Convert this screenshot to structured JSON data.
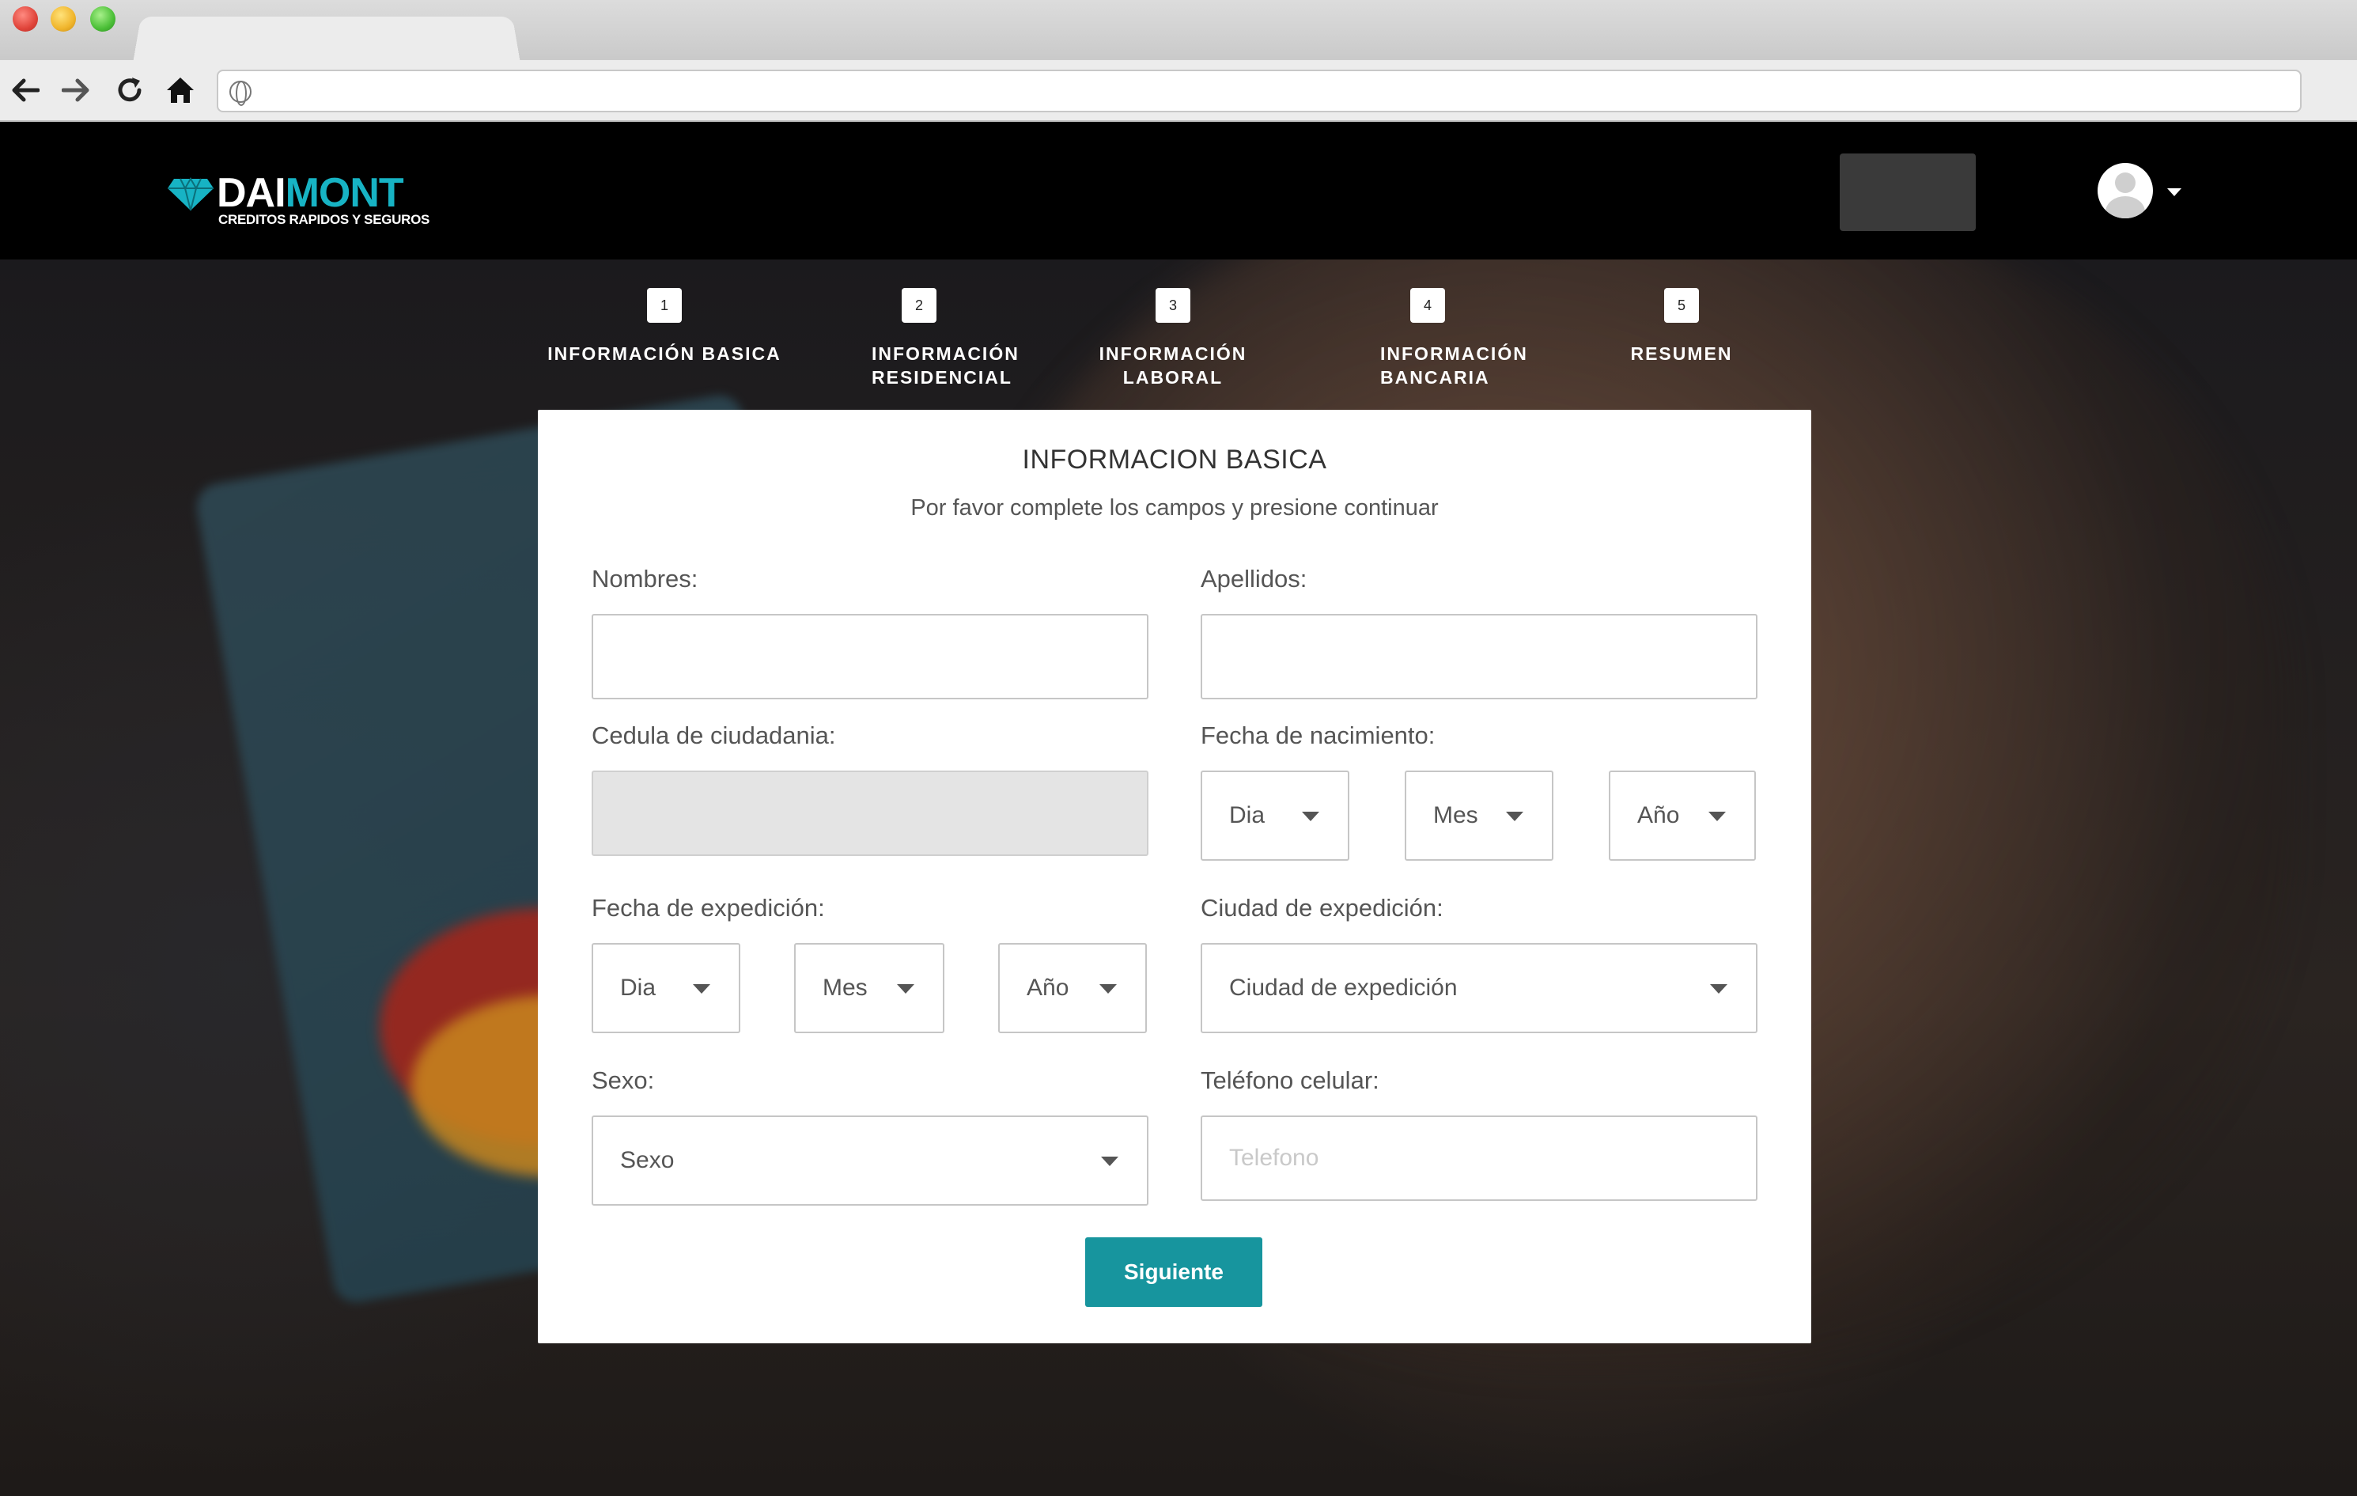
{
  "browser": {
    "url": ""
  },
  "brand": {
    "name_part1": "DAI",
    "name_part2": "MONT",
    "tagline": "CREDITOS RAPIDOS Y SEGUROS",
    "accent_color": "#17b3c4"
  },
  "steps": [
    {
      "number": "1",
      "label": "INFORMACIÓN BASICA"
    },
    {
      "number": "2",
      "label": "INFORMACIÓN RESIDENCIAL"
    },
    {
      "number": "3",
      "label": "INFORMACIÓN LABORAL"
    },
    {
      "number": "4",
      "label": "INFORMACIÓN BANCARIA"
    },
    {
      "number": "5",
      "label": "RESUMEN"
    }
  ],
  "form": {
    "title": "INFORMACION BASICA",
    "subtitle": "Por favor complete los campos y presione continuar",
    "nombres_label": "Nombres:",
    "nombres_value": "",
    "apellidos_label": "Apellidos:",
    "apellidos_value": "",
    "cedula_label": "Cedula de ciudadania:",
    "cedula_value": "",
    "nacimiento_label": "Fecha de nacimiento:",
    "nacimiento_dia": "Dia",
    "nacimiento_mes": "Mes",
    "nacimiento_ano": "Año",
    "expedicion_label": "Fecha de expedición:",
    "expedicion_dia": "Dia",
    "expedicion_mes": "Mes",
    "expedicion_ano": "Año",
    "ciudad_label": "Ciudad de expedición:",
    "ciudad_value": "Ciudad de expedición",
    "sexo_label": "Sexo:",
    "sexo_value": "Sexo",
    "telefono_label": "Teléfono celular:",
    "telefono_placeholder": "Telefono",
    "next_button": "Siguiente",
    "button_color": "#17959e"
  },
  "icons": {
    "back": "arrow-left-icon",
    "forward": "arrow-right-icon",
    "reload": "reload-icon",
    "home": "home-icon",
    "site": "globe-icon",
    "logo": "diamond-icon",
    "user": "user-avatar-icon",
    "menu": "caret-down-icon"
  }
}
